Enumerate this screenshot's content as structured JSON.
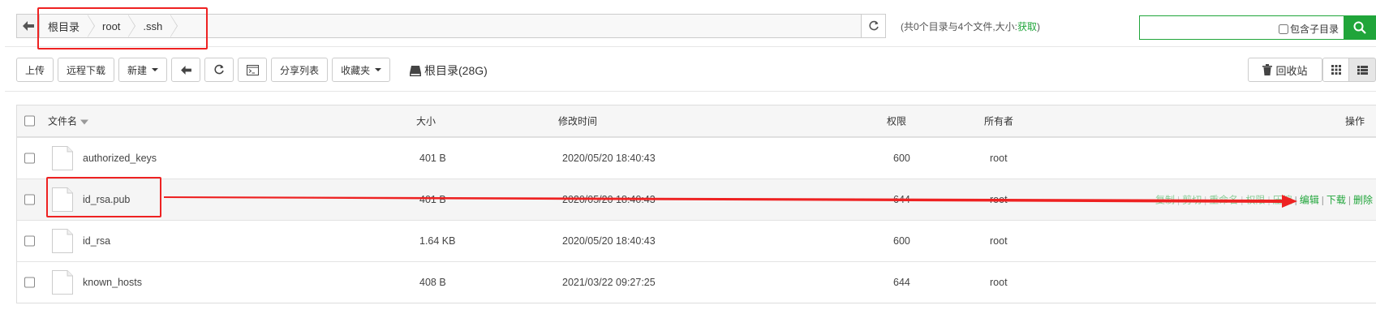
{
  "path": {
    "crumbs": [
      "根目录",
      "root",
      ".ssh"
    ],
    "stats_prefix": "(共0个目录与4个文件,大小:",
    "stats_link": "获取",
    "stats_suffix": ")"
  },
  "search": {
    "placeholder": "",
    "include_sub_label": "包含子目录"
  },
  "toolbar": {
    "upload": "上传",
    "remote_download": "远程下载",
    "new": "新建",
    "share_list": "分享列表",
    "favorites": "收藏夹",
    "disk": "根目录(28G)",
    "recycle_bin": "回收站"
  },
  "table": {
    "headers": {
      "name": "文件名",
      "size": "大小",
      "mtime": "修改时间",
      "perm": "权限",
      "owner": "所有者",
      "ops": "操作"
    },
    "rows": [
      {
        "name": "authorized_keys",
        "size": "401 B",
        "mtime": "2020/05/20 18:40:43",
        "perm": "600",
        "owner": "root"
      },
      {
        "name": "id_rsa.pub",
        "size": "401 B",
        "mtime": "2020/05/20 18:40:43",
        "perm": "644",
        "owner": "root"
      },
      {
        "name": "id_rsa",
        "size": "1.64 KB",
        "mtime": "2020/05/20 18:40:43",
        "perm": "600",
        "owner": "root"
      },
      {
        "name": "known_hosts",
        "size": "408 B",
        "mtime": "2021/03/22 09:27:25",
        "perm": "644",
        "owner": "root"
      }
    ],
    "row_ops": [
      "复制",
      "剪切",
      "重命名",
      "权限",
      "压缩",
      "编辑",
      "下载",
      "删除"
    ]
  },
  "colors": {
    "accent": "#20a53a",
    "annotation": "#ee2222"
  }
}
